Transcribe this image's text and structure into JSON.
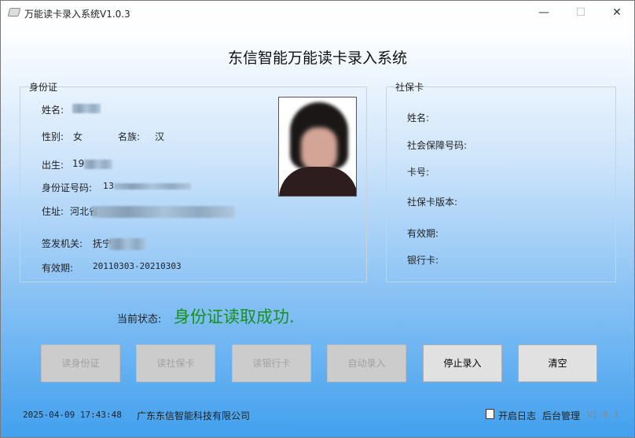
{
  "window": {
    "title": "万能读卡录入系统V1.0.3",
    "minimize": "—",
    "maximize": "☐",
    "close": "✕"
  },
  "heading": "东信智能万能读卡录入系统",
  "id_card": {
    "group_label": "身份证",
    "name_label": "姓名:",
    "name_value": "",
    "gender_label": "性别:",
    "gender_value": "女",
    "ethnicity_label": "名族:",
    "ethnicity_value": "汉",
    "birth_label": "出生:",
    "birth_value": "19",
    "id_number_label": "身份证号码:",
    "id_number_value": "13",
    "address_label": "住址:",
    "address_value": "河北省",
    "authority_label": "签发机关:",
    "authority_value": "抚宁",
    "validity_label": "有效期:",
    "validity_value": "20110303-20210303"
  },
  "social_card": {
    "group_label": "社保卡",
    "name_label": "姓名:",
    "ssn_label": "社会保障号码:",
    "card_no_label": "卡号:",
    "version_label": "社保卡版本:",
    "validity_label": "有效期:",
    "bank_card_label": "银行卡:"
  },
  "status": {
    "label": "当前状态:",
    "value": "身份证读取成功.",
    "color": "#17901e"
  },
  "buttons": [
    {
      "label": "读身份证",
      "enabled": false
    },
    {
      "label": "读社保卡",
      "enabled": false
    },
    {
      "label": "读银行卡",
      "enabled": false
    },
    {
      "label": "自动录入",
      "enabled": false
    },
    {
      "label": "停止录入",
      "enabled": true
    },
    {
      "label": "清空",
      "enabled": true
    }
  ],
  "footer": {
    "datetime": "2025-04-09 17:43:48",
    "company": "广东东信智能科技有限公司",
    "log_checkbox": "开启日志",
    "log_checked": false,
    "admin": "后台管理",
    "version": "V1.0.3"
  }
}
